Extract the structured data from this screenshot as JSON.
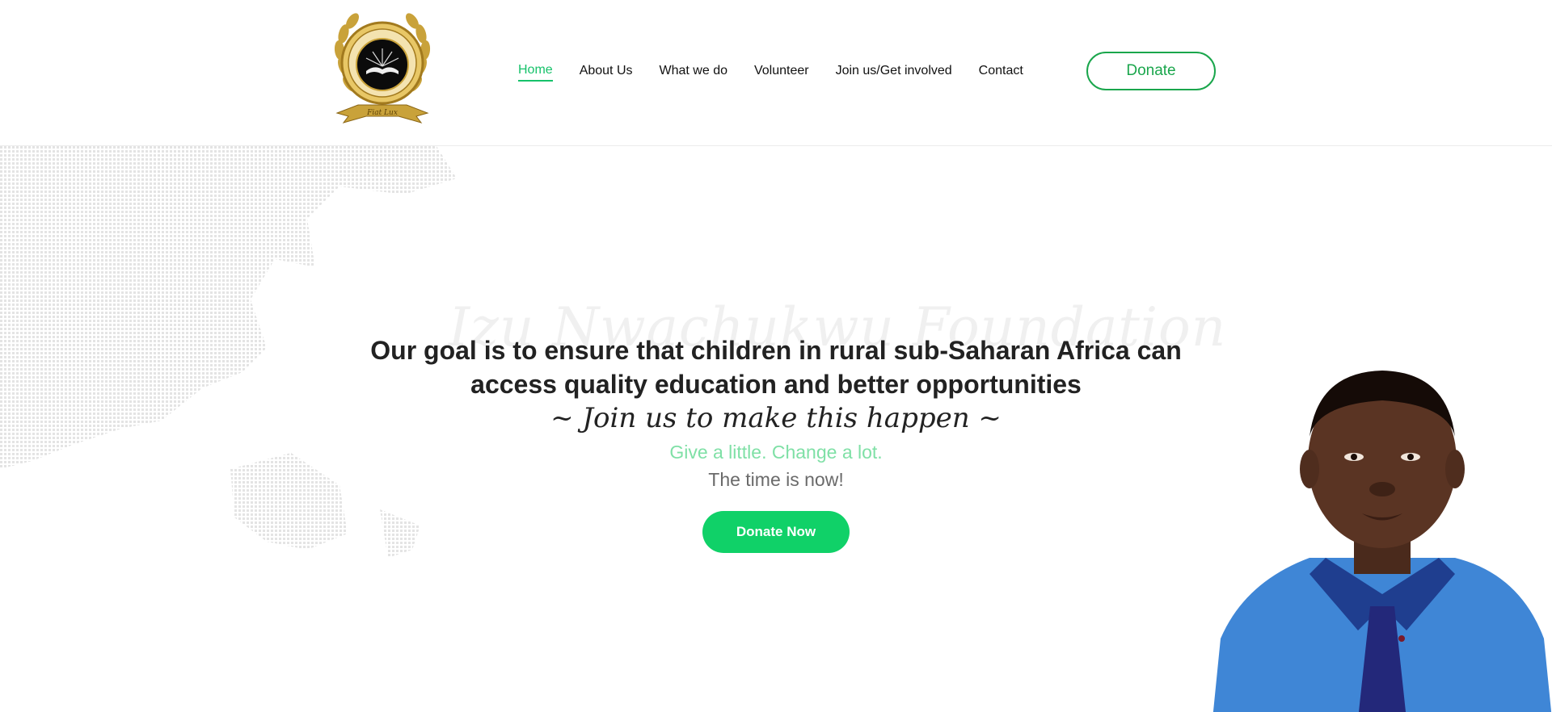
{
  "brand": {
    "logo_text": "IZU NWACHUKWU FOUNDATION",
    "motto": "Fiat Lux",
    "logo_icon": "book-emblem-icon"
  },
  "nav": {
    "items": [
      {
        "label": "Home",
        "active": true
      },
      {
        "label": "About Us",
        "active": false
      },
      {
        "label": "What we do",
        "active": false
      },
      {
        "label": "Volunteer",
        "active": false
      },
      {
        "label": "Join us/Get involved",
        "active": false
      },
      {
        "label": "Contact",
        "active": false
      }
    ],
    "donate_label": "Donate"
  },
  "hero": {
    "watermark": "Izu Nwachukwu Foundation",
    "headline_line1": "Our goal is to ensure that children in rural sub-Saharan Africa can",
    "headline_line2": "access quality education and better opportunities",
    "join": "~ Join us to make this happen ~",
    "tagline": "Give a little. Change a lot.",
    "time": "The time is now!",
    "donate_now_label": "Donate Now"
  },
  "colors": {
    "accent": "#10d168",
    "nav_active": "#16c26a",
    "donate_border": "#1aa64c",
    "tagline": "#7fe0a6"
  }
}
